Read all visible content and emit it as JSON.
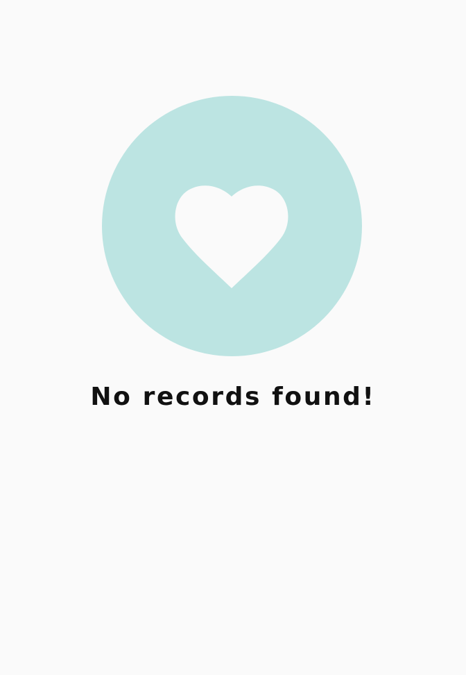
{
  "empty_state": {
    "icon": "heart-icon",
    "message": "No records found!"
  },
  "colors": {
    "background": "#fafafa",
    "circle": "#bce4e2",
    "icon": "#fafafa",
    "text": "#111111"
  }
}
